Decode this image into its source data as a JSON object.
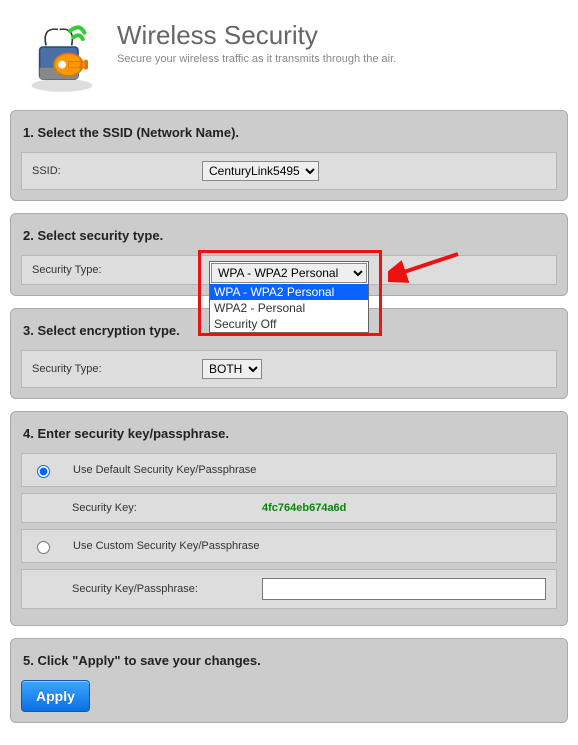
{
  "header": {
    "title": "Wireless Security",
    "subtitle": "Secure your wireless traffic as it transmits through the air."
  },
  "panel1": {
    "title": "1. Select the SSID (Network Name).",
    "ssid_label": "SSID:",
    "ssid_selected": "CenturyLink5495"
  },
  "panel2": {
    "title": "2. Select security type.",
    "type_label": "Security Type:",
    "dropdown_selected": "WPA - WPA2 Personal",
    "options": {
      "0": "WPA - WPA2 Personal",
      "1": "WPA2 - Personal",
      "2": "Security Off"
    }
  },
  "panel3": {
    "title": "3. Select encryption type.",
    "type_label": "Security Type:",
    "enc_selected": "BOTH"
  },
  "panel4": {
    "title": "4. Enter security key/passphrase.",
    "radio_default": "Use Default Security Key/Passphrase",
    "seckey_label": "Security Key:",
    "seckey_value": "4fc764eb674a6d",
    "radio_custom": "Use Custom Security Key/Passphrase",
    "passphrase_label": "Security Key/Passphrase:"
  },
  "panel5": {
    "title": "5. Click \"Apply\" to save your changes.",
    "apply_label": "Apply"
  }
}
